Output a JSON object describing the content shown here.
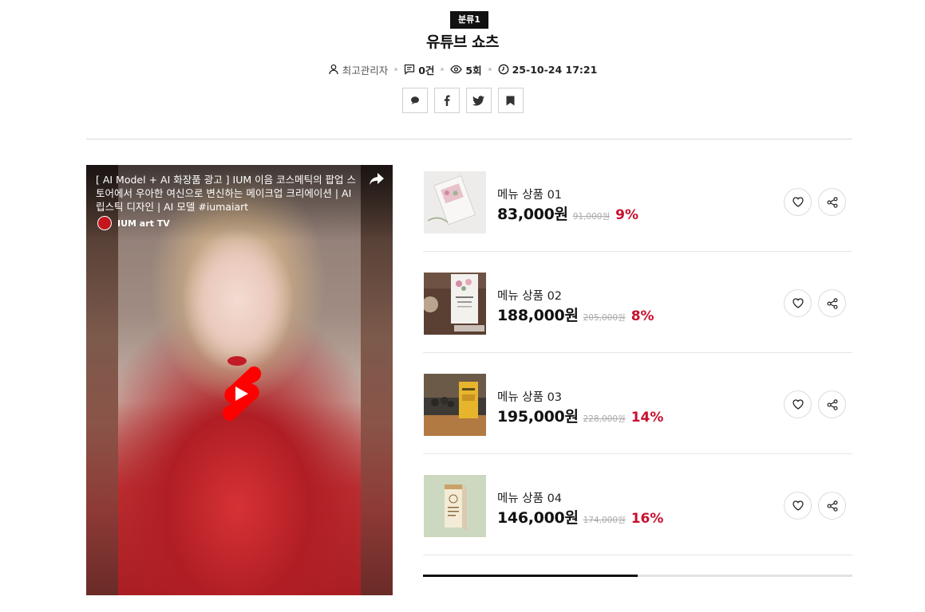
{
  "post": {
    "category": "분류1",
    "title": "유튜브 쇼츠",
    "author": "최고관리자",
    "comments": "0건",
    "views": "5회",
    "datetime": "25-10-24 17:21"
  },
  "share_buttons": [
    "comment-icon",
    "facebook-icon",
    "twitter-icon",
    "bookmark-icon"
  ],
  "video": {
    "title": "[ AI Model + AI 화장품 광고 ] IUM 이음 코스메틱의 팝업 스토어에서 우아한 여신으로 변신하는 메이크업 크리에이션 | AI 립스틱 디자인 | AI 모델 #iumaiart",
    "channel": "IUM art TV",
    "watermark": "IUM"
  },
  "products": [
    {
      "name": "메뉴 상품 01",
      "price": "83,000원",
      "original_price": "91,000원",
      "discount": "9%"
    },
    {
      "name": "메뉴 상품 02",
      "price": "188,000원",
      "original_price": "205,000원",
      "discount": "8%"
    },
    {
      "name": "메뉴 상품 03",
      "price": "195,000원",
      "original_price": "228,000원",
      "discount": "14%"
    },
    {
      "name": "메뉴 상품 04",
      "price": "146,000원",
      "original_price": "174,000원",
      "discount": "16%"
    }
  ],
  "slider_progress": 0.5,
  "colors": {
    "accent": "#c8102e",
    "badge_bg": "#111111",
    "youtube_red": "#ff0000"
  }
}
